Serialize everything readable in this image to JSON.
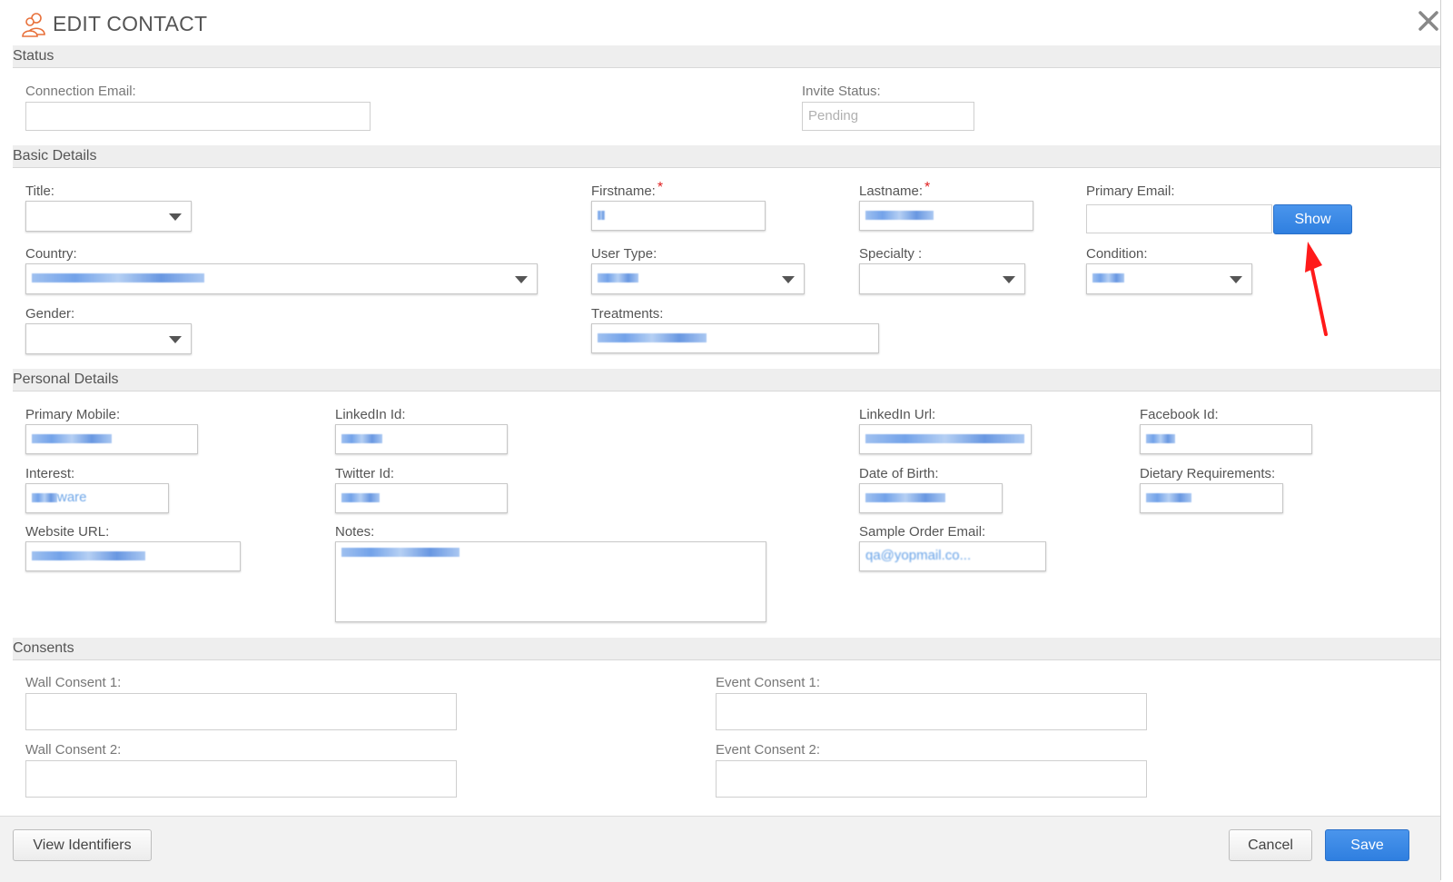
{
  "dialog": {
    "title": "EDIT CONTACT"
  },
  "sections": {
    "status": "Status",
    "basic": "Basic Details",
    "personal": "Personal Details",
    "consents": "Consents"
  },
  "status": {
    "connection_email_label": "Connection Email:",
    "connection_email_value": "",
    "invite_status_label": "Invite Status:",
    "invite_status_value": "Pending"
  },
  "basic": {
    "title_label": "Title:",
    "firstname_label": "Firstname:",
    "lastname_label": "Lastname:",
    "primary_email_label": "Primary Email:",
    "show_button": "Show",
    "country_label": "Country:",
    "user_type_label": "User Type:",
    "specialty_label": "Specialty :",
    "condition_label": "Condition:",
    "gender_label": "Gender:",
    "treatments_label": "Treatments:",
    "required_mark": "*"
  },
  "personal": {
    "primary_mobile_label": "Primary Mobile:",
    "linkedin_id_label": "LinkedIn Id:",
    "linkedin_url_label": "LinkedIn Url:",
    "facebook_id_label": "Facebook Id:",
    "interest_label": "Interest:",
    "interest_value_visible": "ware",
    "twitter_id_label": "Twitter Id:",
    "dob_label": "Date of Birth:",
    "dietary_label": "Dietary Requirements:",
    "website_label": "Website URL:",
    "notes_label": "Notes:",
    "sample_order_email_label": "Sample Order Email:",
    "sample_order_email_visible": "qa@yopmail.co..."
  },
  "consents": {
    "wall1_label": "Wall Consent 1:",
    "event1_label": "Event Consent 1:",
    "wall2_label": "Wall Consent 2:",
    "event2_label": "Event Consent 2:"
  },
  "footer": {
    "view_identifiers": "View Identifiers",
    "cancel": "Cancel",
    "save": "Save"
  },
  "colors": {
    "accent": "#2f7fe0",
    "required": "#e02020",
    "section_bg": "#eeeeee",
    "annotation_arrow": "#ff0000"
  },
  "icons": {
    "title": "contacts-icon",
    "close": "close-icon",
    "dropdown": "caret-down-icon"
  }
}
